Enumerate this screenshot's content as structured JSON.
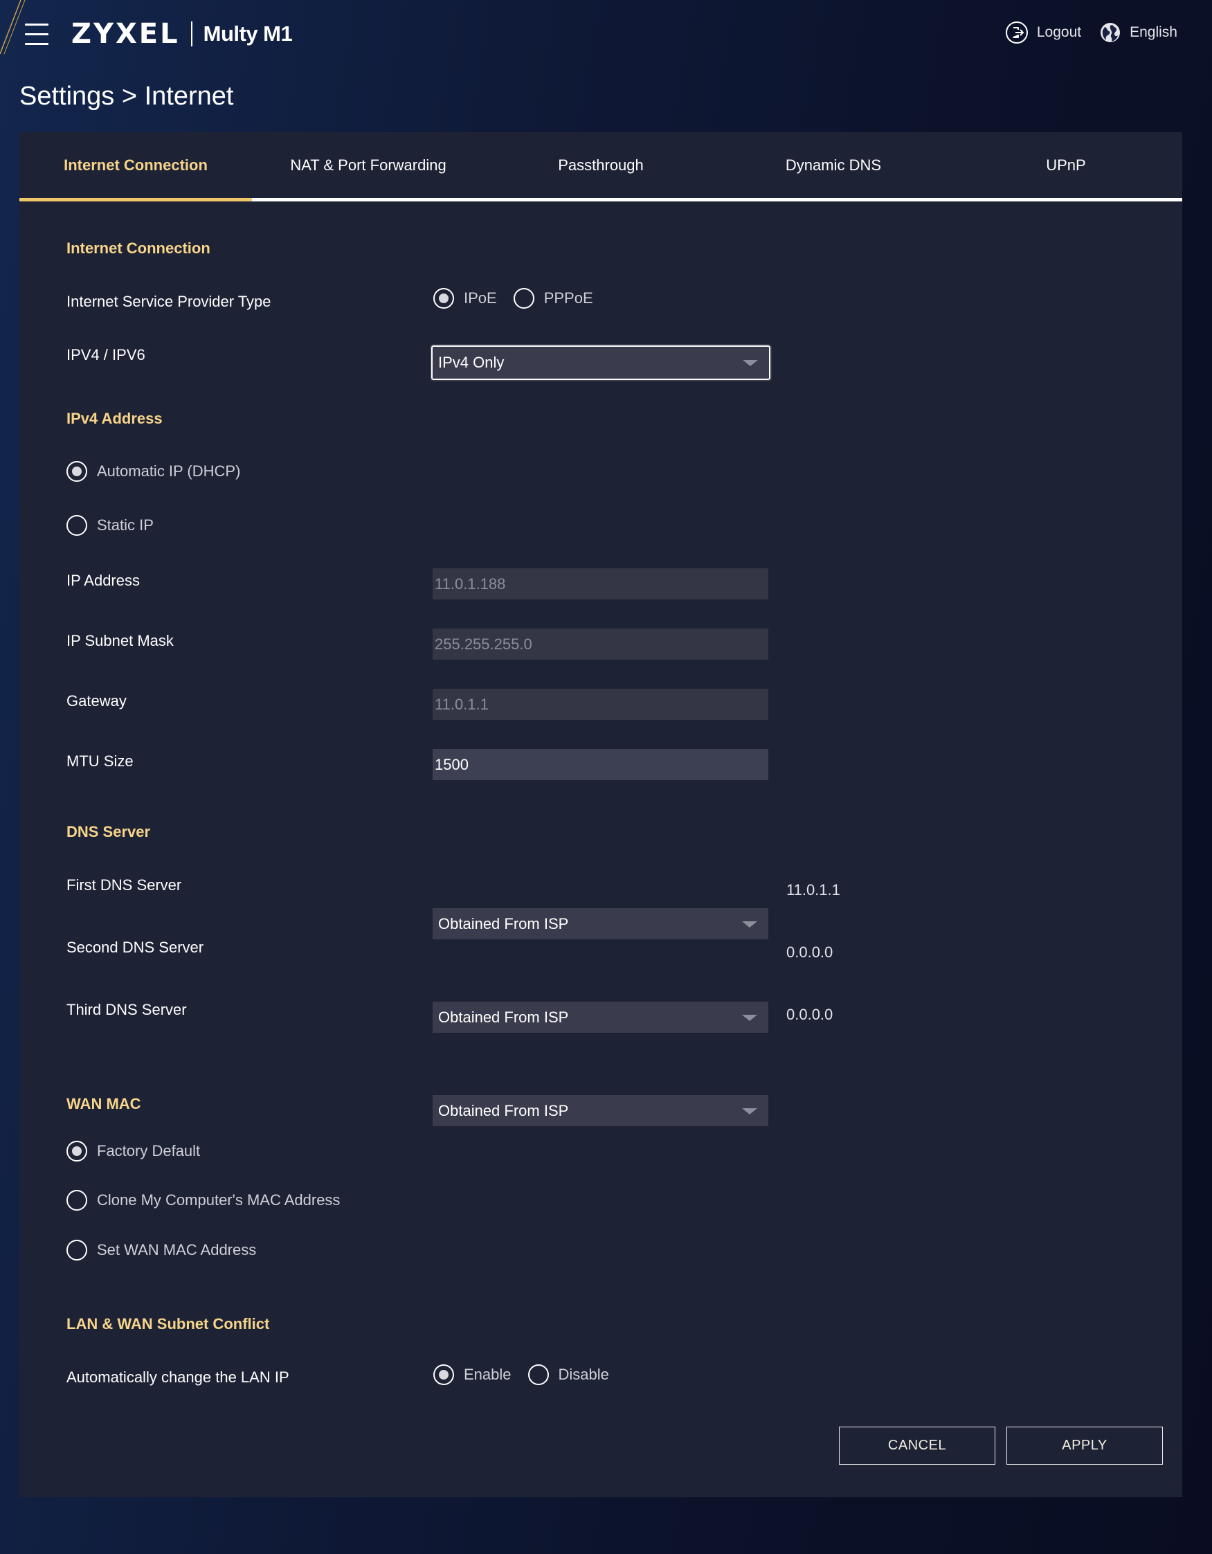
{
  "header": {
    "brand": "ZYXEL",
    "model": "Multy M1",
    "logout_label": "Logout",
    "language_label": "English"
  },
  "page_title": "Settings > Internet",
  "tabs": [
    {
      "label": "Internet Connection",
      "active": true
    },
    {
      "label": "NAT & Port Forwarding",
      "active": false
    },
    {
      "label": "Passthrough",
      "active": false
    },
    {
      "label": "Dynamic DNS",
      "active": false
    },
    {
      "label": "UPnP",
      "active": false
    }
  ],
  "internet_connection": {
    "title": "Internet Connection",
    "isp_type_label": "Internet Service Provider Type",
    "isp_options": [
      {
        "label": "IPoE",
        "checked": true
      },
      {
        "label": "PPPoE",
        "checked": false
      }
    ],
    "ip_version_label": "IPV4 / IPV6",
    "ip_version_value": "IPv4 Only"
  },
  "ipv4": {
    "title": "IPv4 Address",
    "auto_label": "Automatic IP (DHCP)",
    "static_label": "Static IP",
    "ip_address_label": "IP Address",
    "ip_address_value": "11.0.1.188",
    "subnet_label": "IP Subnet Mask",
    "subnet_value": "255.255.255.0",
    "gateway_label": "Gateway",
    "gateway_value": "11.0.1.1",
    "mtu_label": "MTU Size",
    "mtu_value": "1500"
  },
  "dns": {
    "title": "DNS Server",
    "servers": [
      {
        "label": "First DNS Server",
        "mode": "Obtained From ISP",
        "value": "11.0.1.1"
      },
      {
        "label": "Second DNS Server",
        "mode": "Obtained From ISP",
        "value": "0.0.0.0"
      },
      {
        "label": "Third DNS Server",
        "mode": "Obtained From ISP",
        "value": "0.0.0.0"
      }
    ]
  },
  "wan_mac": {
    "title": "WAN MAC",
    "options": [
      {
        "label": "Factory Default",
        "checked": true
      },
      {
        "label": "Clone My Computer's MAC Address",
        "checked": false
      },
      {
        "label": "Set WAN MAC Address",
        "checked": false
      }
    ]
  },
  "subnet_conflict": {
    "title": "LAN & WAN Subnet Conflict",
    "auto_change_label": "Automatically change the LAN IP",
    "options": [
      {
        "label": "Enable",
        "checked": true
      },
      {
        "label": "Disable",
        "checked": false
      }
    ]
  },
  "actions": {
    "cancel_label": "CANCEL",
    "apply_label": "APPLY"
  },
  "colors": {
    "accent": "#f7d58a",
    "panel": "#1e2235",
    "field": "#3a3c4d"
  }
}
